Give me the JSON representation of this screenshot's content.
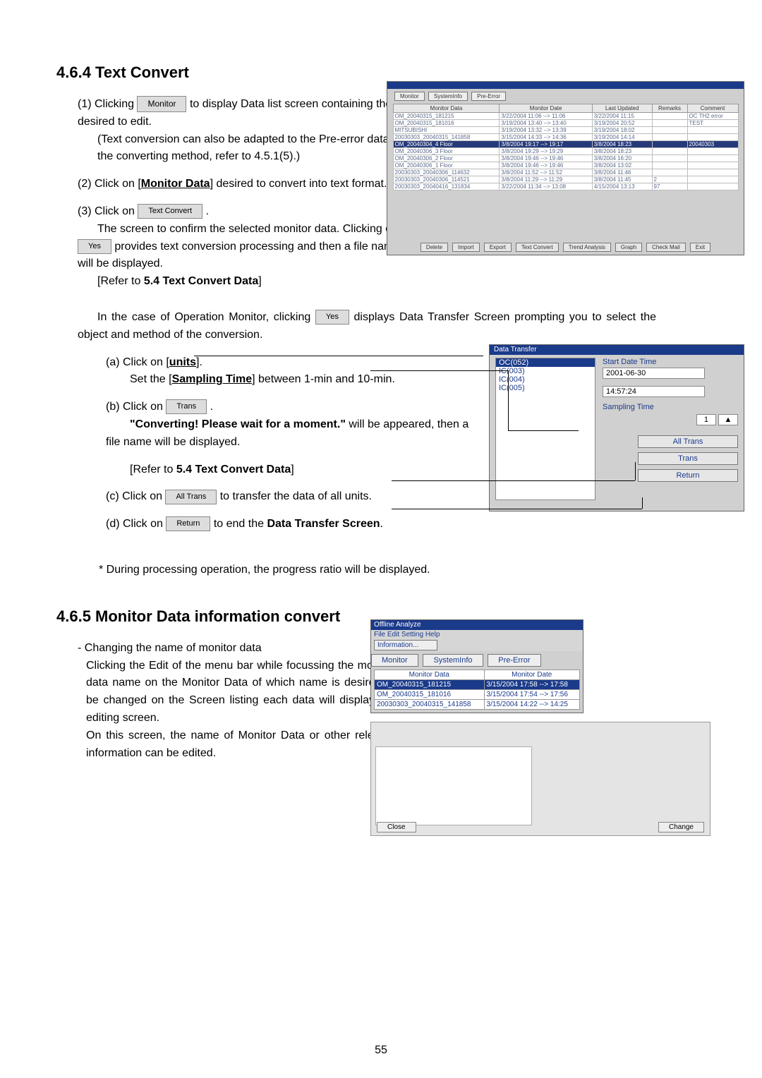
{
  "page_number": "55",
  "section_464": {
    "title": "4.6.4 Text Convert",
    "steps": {
      "s1_a": "(1)  Clicking",
      "s1_b": "to display Data list screen containing the file desired to edit.",
      "s1_c": "(Text conversion can also be adapted to the Pre-error data. For the converting method, refer to 4.5.1(5).)",
      "btn_monitor": "Monitor",
      "s2": "(2)  Click on [",
      "s2_link": "Monitor Data",
      "s2_end": "] desired to convert into text format.",
      "s3_a": "(3)  Click on",
      "s3_b": ".",
      "s3_c": "The screen to confirm the selected monitor data. Clicking on",
      "s3_d": "provides text conversion processing and then a file name will be displayed.",
      "s3_ref": "[Refer to 5.4 Text Convert Data]",
      "btn_textconvert": "Text Convert",
      "btn_yes": "Yes",
      "s3_om": "In the case of Operation Monitor, clicking",
      "s3_om_end": "displays Data Transfer Screen prompting you to select the object and method of the conversion.",
      "a_a": "(a)   Click on [",
      "a_link": "units",
      "a_b": "].",
      "a_c": "Set the [",
      "a_link2": "Sampling Time",
      "a_d": "] between 1-min and 10-min.",
      "b_a": "(b)   Click on",
      "b_b": ".",
      "b_c": "\"Converting! Please wait for a moment.\"",
      "b_d": "will be appeared, then a file name will be displayed.",
      "b_ref": "[Refer to 5.4 Text Convert Data]",
      "btn_trans": "Trans",
      "c_a": "(c)   Click on",
      "c_b": "to transfer the data of all units.",
      "btn_alltrans": "All Trans",
      "d_a": "(d)   Click on",
      "d_b": "to end the Data Transfer Screen.",
      "btn_return": "Return",
      "note": "*  During processing operation, the progress ratio will be displayed."
    }
  },
  "shot1": {
    "tabs": [
      "Monitor",
      "SystemInfo",
      "Pre-Error"
    ],
    "headers": [
      "Monitor Data",
      "Monitor Date",
      "Last Updated",
      "Remarks",
      "Comment"
    ],
    "rows": [
      [
        "OM_20040315_181215",
        "3/22/2004 11:06 --> 11:06",
        "3/22/2004 11:15",
        "",
        "OC TH2 error"
      ],
      [
        "OM_20040315_181016",
        "3/19/2004 13:40 --> 13:40",
        "3/19/2004 20:52",
        "",
        "TEST"
      ],
      [
        "MITSUBISHI",
        "3/19/2004 13:32 --> 13:39",
        "3/19/2004 18:02",
        "",
        ""
      ],
      [
        "20030303_20040315_141858",
        "3/15/2004 14:33 --> 14:36",
        "3/19/2004 14:14",
        "",
        ""
      ],
      [
        "OM_20040304_4 Floor",
        "3/8/2004 19:17 --> 19:17",
        "3/8/2004 18:23",
        "",
        "20040303"
      ],
      [
        "OM_20040306_3 Floor",
        "3/8/2004 19:29 --> 19:29",
        "3/8/2004 18:23",
        "",
        ""
      ],
      [
        "OM_20040306_2 Floor",
        "3/8/2004 19:46 --> 19:46",
        "3/8/2004 16:20",
        "",
        ""
      ],
      [
        "OM_20040306_1 Floor",
        "3/8/2004 19:46 --> 19:46",
        "3/8/2004 13:02",
        "",
        ""
      ],
      [
        "20030303_20040306_114632",
        "3/8/2004 11:52 --> 11:52",
        "3/8/2004 11:46",
        "",
        ""
      ],
      [
        "20030303_20040306_114521",
        "3/8/2004 11:29 --> 11:29",
        "3/8/2004 11:45",
        "2",
        ""
      ],
      [
        "20030303_20040416_131834",
        "3/22/2004 11:34 --> 13:08",
        "4/15/2004 13:13",
        "97",
        ""
      ]
    ],
    "sel_idx": 4,
    "bottom_buttons": [
      "Delete",
      "Import",
      "Export",
      "Text Convert",
      "Trend Analysis",
      "Graph",
      "Check Mail",
      "Exit"
    ]
  },
  "shot2": {
    "title": "Data Transfer",
    "list": [
      "OC(052)",
      "IC(003)",
      "IC(004)",
      "IC(005)"
    ],
    "r_labels": {
      "start": "Start Date Time",
      "sampling": "Sampling Time"
    },
    "date": "2001-06-30",
    "time": "14:57:24",
    "buttons": {
      "alltrans": "All Trans",
      "trans": "Trans",
      "return": "Return"
    }
  },
  "section_465": {
    "title": "4.6.5 Monitor Data information convert",
    "p1": "- Changing the name of monitor data",
    "p2": "Clicking the Edit of the menu bar while focussing the monitor data name on the Monitor Data of which name is desired to be changed on the Screen listing each data will display the editing screen.",
    "p3": "On this screen, the name of Monitor Data or other relevant information can be edited."
  },
  "shot3": {
    "wintitle": "Offline Analyze",
    "menubar": "File  Edit  Setting  Help",
    "dropitem": "Information...",
    "tabs": [
      "Monitor",
      "SystemInfo",
      "Pre-Error"
    ],
    "th": [
      "Monitor Data",
      "Monitor Date"
    ],
    "rows": [
      [
        "OM_20040315_181215",
        "3/15/2004 17:58 --> 17:58"
      ],
      [
        "OM_20040315_181016",
        "3/15/2004 17:54 --> 17:56"
      ],
      [
        "20030303_20040315_141858",
        "3/15/2004 14:22 --> 14:25"
      ]
    ],
    "btn_close": "Close",
    "btn_change": "Change"
  }
}
